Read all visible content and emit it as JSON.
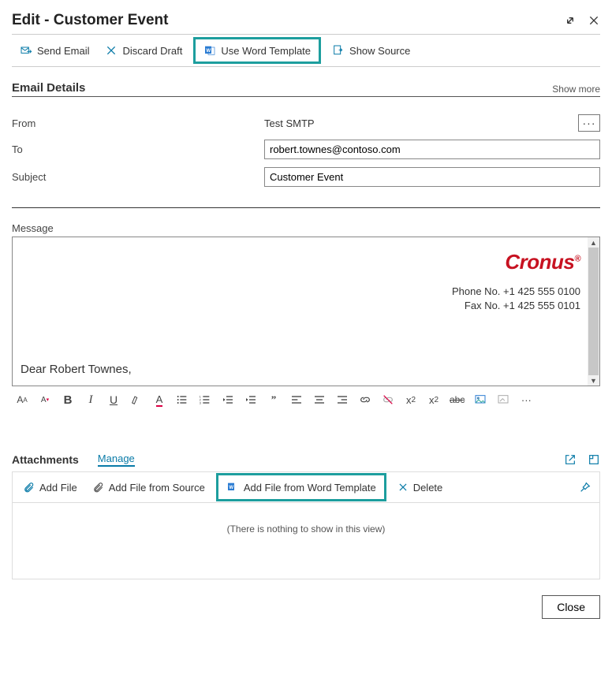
{
  "header": {
    "title": "Edit - Customer Event"
  },
  "toolbar": {
    "send_email": "Send Email",
    "discard_draft": "Discard Draft",
    "use_word_template": "Use Word Template",
    "show_source": "Show Source"
  },
  "section": {
    "title": "Email Details",
    "show_more": "Show more"
  },
  "form": {
    "from_label": "From",
    "from_value": "Test SMTP",
    "to_label": "To",
    "to_value": "robert.townes@contoso.com",
    "subject_label": "Subject",
    "subject_value": "Customer Event"
  },
  "message": {
    "label": "Message",
    "brand": "Cronus",
    "phone": "Phone No. +1 425 555 0100",
    "fax": "Fax No. +1 425 555 0101",
    "greeting": "Dear Robert Townes,"
  },
  "attachments": {
    "title": "Attachments",
    "manage": "Manage",
    "add_file": "Add File",
    "add_from_source": "Add File from Source",
    "add_from_word": "Add File from Word Template",
    "delete": "Delete",
    "empty": "(There is nothing to show in this view)"
  },
  "footer": {
    "close": "Close"
  }
}
